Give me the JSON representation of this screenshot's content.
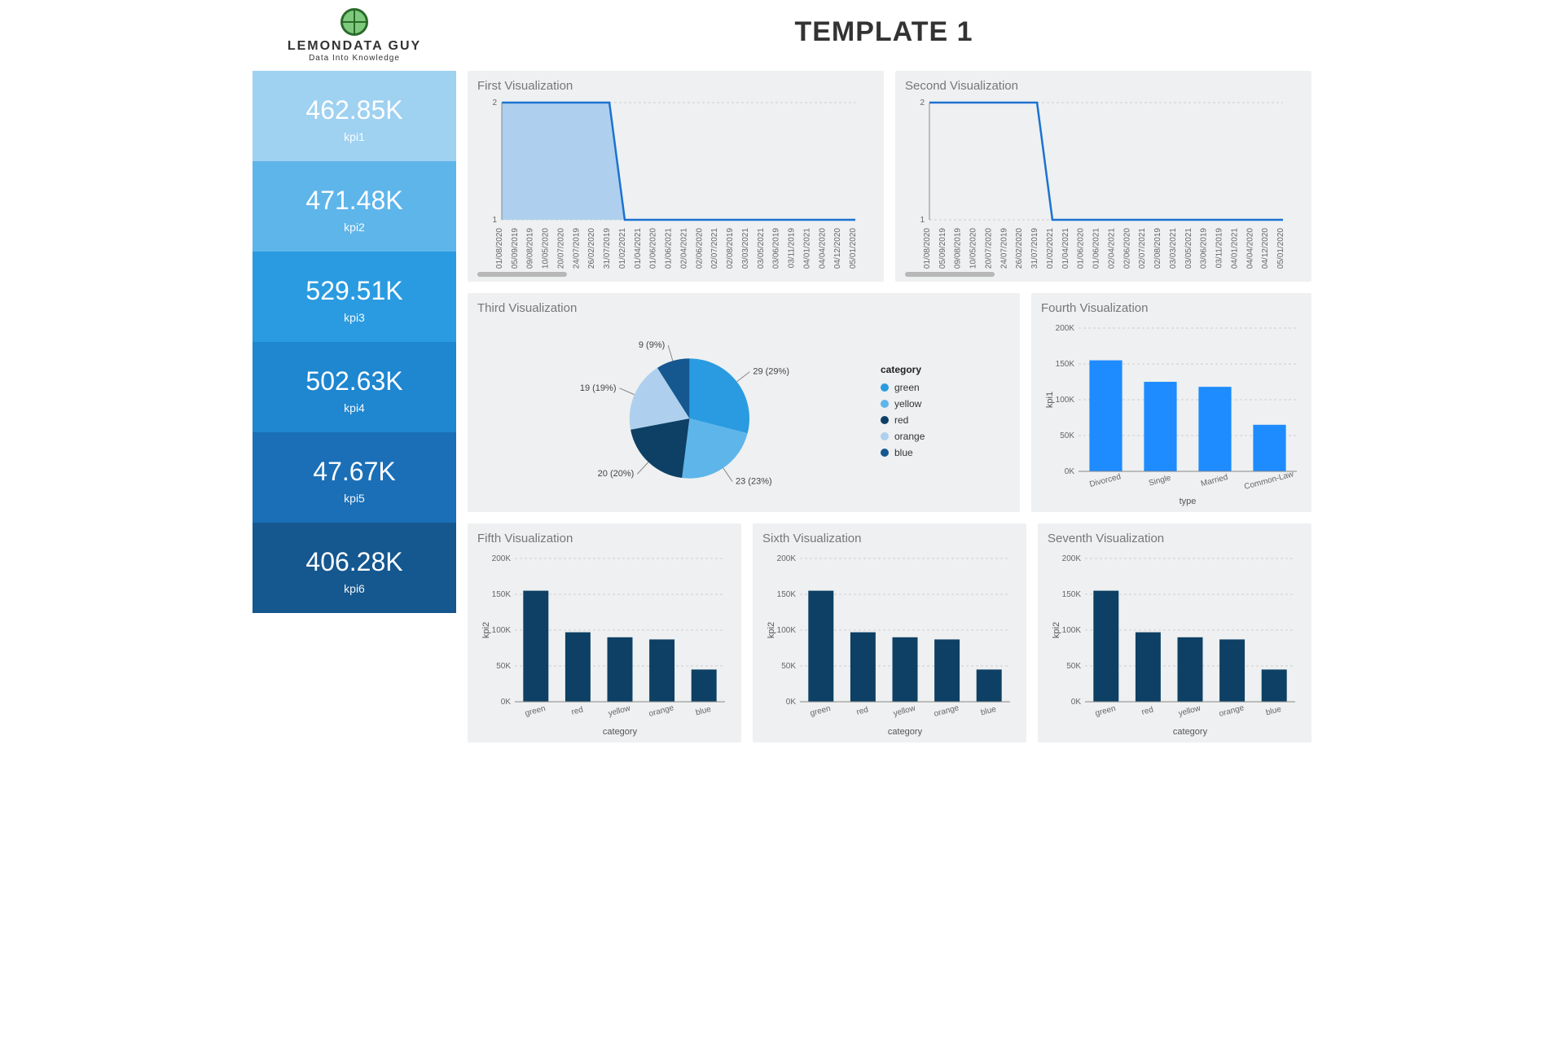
{
  "logo": {
    "name": "LEMONDATA GUY",
    "tagline": "Data Into Knowledge"
  },
  "page_title": "TEMPLATE 1",
  "kpi_colors": [
    "#9fd1f1",
    "#5eb5ea",
    "#2a9be0",
    "#1f86d0",
    "#1a6fb7",
    "#15578f"
  ],
  "kpis": [
    {
      "value": "462.85K",
      "label": "kpi1"
    },
    {
      "value": "471.48K",
      "label": "kpi2"
    },
    {
      "value": "529.51K",
      "label": "kpi3"
    },
    {
      "value": "502.63K",
      "label": "kpi4"
    },
    {
      "value": "47.67K",
      "label": "kpi5"
    },
    {
      "value": "406.28K",
      "label": "kpi6"
    }
  ],
  "viz_titles": {
    "v1": "First Visualization",
    "v2": "Second Visualization",
    "v3": "Third Visualization",
    "v4": "Fourth Visualization",
    "v5": "Fifth Visualization",
    "v6": "Sixth Visualization",
    "v7": "Seventh Visualization"
  },
  "chart_data": [
    {
      "id": "v1",
      "type": "area",
      "x": [
        "01/08/2020",
        "05/09/2019",
        "09/08/2019",
        "10/05/2020",
        "20/07/2020",
        "24/07/2019",
        "26/02/2020",
        "31/07/2019",
        "01/02/2021",
        "01/04/2021",
        "01/06/2020",
        "01/06/2021",
        "02/04/2021",
        "02/06/2020",
        "02/07/2021",
        "02/08/2019",
        "03/03/2021",
        "03/05/2021",
        "03/06/2019",
        "03/11/2019",
        "04/01/2021",
        "04/04/2020",
        "04/12/2020",
        "05/01/2020"
      ],
      "values": [
        2,
        2,
        2,
        2,
        2,
        2,
        2,
        2,
        1,
        1,
        1,
        1,
        1,
        1,
        1,
        1,
        1,
        1,
        1,
        1,
        1,
        1,
        1,
        1
      ],
      "ylim": [
        1,
        2
      ]
    },
    {
      "id": "v2",
      "type": "line",
      "x": [
        "01/08/2020",
        "05/09/2019",
        "09/08/2019",
        "10/05/2020",
        "20/07/2020",
        "24/07/2019",
        "26/02/2020",
        "31/07/2019",
        "01/02/2021",
        "01/04/2021",
        "01/06/2020",
        "01/06/2021",
        "02/04/2021",
        "02/06/2020",
        "02/07/2021",
        "02/08/2019",
        "03/03/2021",
        "03/05/2021",
        "03/06/2019",
        "03/11/2019",
        "04/01/2021",
        "04/04/2020",
        "04/12/2020",
        "05/01/2020"
      ],
      "values": [
        2,
        2,
        2,
        2,
        2,
        2,
        2,
        2,
        1,
        1,
        1,
        1,
        1,
        1,
        1,
        1,
        1,
        1,
        1,
        1,
        1,
        1,
        1,
        1
      ],
      "ylim": [
        1,
        2
      ]
    },
    {
      "id": "v3",
      "type": "pie",
      "legend_title": "category",
      "slices": [
        {
          "name": "green",
          "value": 29,
          "label": "29 (29%)",
          "color": "#2a9be0"
        },
        {
          "name": "yellow",
          "value": 23,
          "label": "23 (23%)",
          "color": "#5eb5ea"
        },
        {
          "name": "red",
          "value": 20,
          "label": "20 (20%)",
          "color": "#0d4064"
        },
        {
          "name": "orange",
          "value": 19,
          "label": "19 (19%)",
          "color": "#aed0ee"
        },
        {
          "name": "blue",
          "value": 9,
          "label": "9 (9%)",
          "color": "#15578f"
        }
      ]
    },
    {
      "id": "v4",
      "type": "bar",
      "xlabel": "type",
      "ylabel": "kpi1",
      "categories": [
        "Divorced",
        "Single",
        "Married",
        "Common-Law"
      ],
      "values": [
        155000,
        125000,
        118000,
        65000
      ],
      "ylim": [
        0,
        200000
      ],
      "yticks": [
        "0K",
        "50K",
        "100K",
        "150K",
        "200K"
      ],
      "bar_color": "#1e8bff"
    },
    {
      "id": "v5",
      "type": "bar",
      "xlabel": "category",
      "ylabel": "kpi2",
      "categories": [
        "green",
        "red",
        "yellow",
        "orange",
        "blue"
      ],
      "values": [
        155000,
        97000,
        90000,
        87000,
        45000
      ],
      "ylim": [
        0,
        200000
      ],
      "yticks": [
        "0K",
        "50K",
        "100K",
        "150K",
        "200K"
      ],
      "bar_color": "#0d4064"
    },
    {
      "id": "v6",
      "type": "bar",
      "xlabel": "category",
      "ylabel": "kpi2",
      "categories": [
        "green",
        "red",
        "yellow",
        "orange",
        "blue"
      ],
      "values": [
        155000,
        97000,
        90000,
        87000,
        45000
      ],
      "ylim": [
        0,
        200000
      ],
      "yticks": [
        "0K",
        "50K",
        "100K",
        "150K",
        "200K"
      ],
      "bar_color": "#0d4064"
    },
    {
      "id": "v7",
      "type": "bar",
      "xlabel": "category",
      "ylabel": "kpi2",
      "categories": [
        "green",
        "red",
        "yellow",
        "orange",
        "blue"
      ],
      "values": [
        155000,
        97000,
        90000,
        87000,
        45000
      ],
      "ylim": [
        0,
        200000
      ],
      "yticks": [
        "0K",
        "50K",
        "100K",
        "150K",
        "200K"
      ],
      "bar_color": "#0d4064"
    }
  ]
}
